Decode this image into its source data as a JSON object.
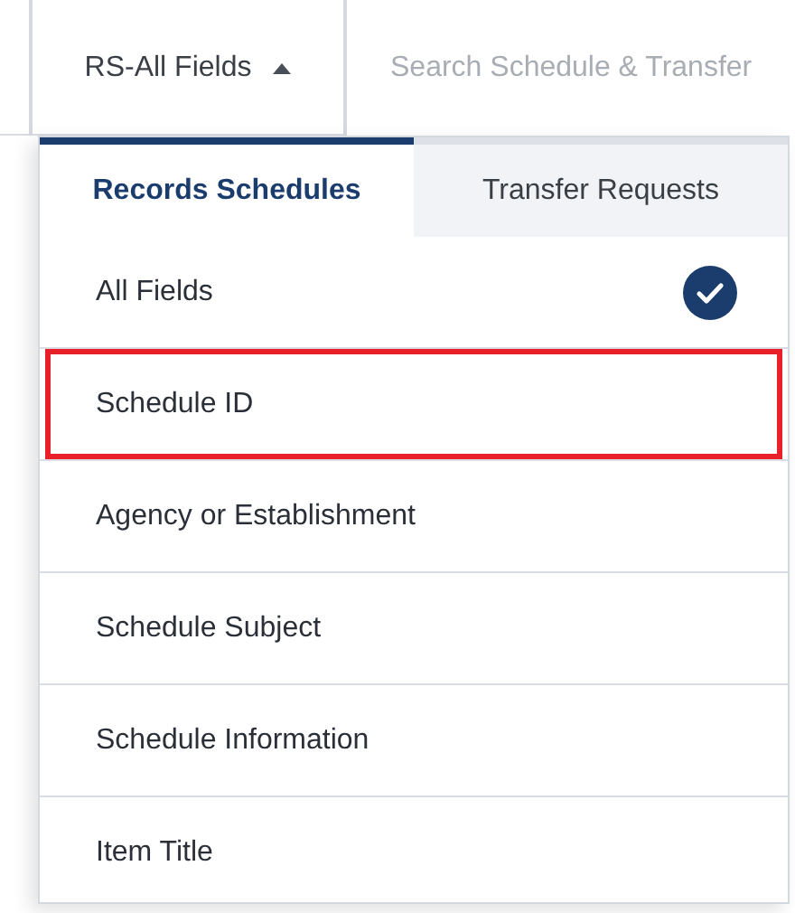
{
  "field_select": {
    "label": "RS-All Fields",
    "expanded": true
  },
  "search": {
    "placeholder": "Search Schedule & Transfer"
  },
  "tabs": [
    {
      "label": "Records Schedules",
      "selected": true
    },
    {
      "label": "Transfer Requests",
      "selected": false
    }
  ],
  "options": [
    {
      "label": "All Fields",
      "checked": true,
      "highlighted": false
    },
    {
      "label": "Schedule ID",
      "checked": false,
      "highlighted": true
    },
    {
      "label": "Agency or Establishment",
      "checked": false,
      "highlighted": false
    },
    {
      "label": "Schedule Subject",
      "checked": false,
      "highlighted": false
    },
    {
      "label": "Schedule Information",
      "checked": false,
      "highlighted": false
    },
    {
      "label": "Item Title",
      "checked": false,
      "highlighted": false
    }
  ]
}
